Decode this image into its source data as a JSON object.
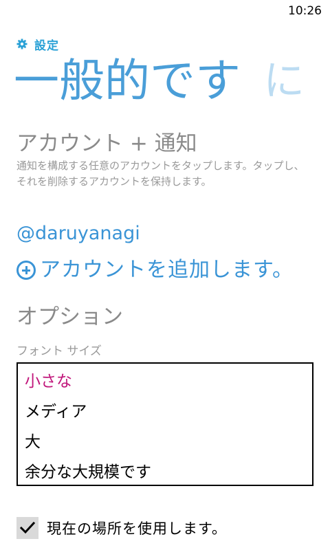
{
  "status_bar": {
    "time": "10:26"
  },
  "app": {
    "title": "設定"
  },
  "pivot": {
    "items": [
      {
        "label": "一般的です"
      },
      {
        "label": "に"
      }
    ]
  },
  "accounts": {
    "header": "アカウント + 通知",
    "description": "通知を構成する任意のアカウントをタップします。タップし、それを削除するアカウントを保持します。",
    "items": [
      {
        "name": "@daruyanagi"
      }
    ],
    "add_label": "アカウントを追加します。"
  },
  "options": {
    "header": "オプション",
    "font_size": {
      "label": "フォント サイズ",
      "options": [
        {
          "label": "小さな"
        },
        {
          "label": "メディア"
        },
        {
          "label": "大"
        },
        {
          "label": "余分な大規模です"
        }
      ],
      "selected": "小さな"
    },
    "location": {
      "label": "現在の場所を使用します。",
      "checked": true
    }
  },
  "colors": {
    "accent": "#4a9ed8",
    "selected": "#c0157a",
    "muted": "#8a8a8a"
  }
}
